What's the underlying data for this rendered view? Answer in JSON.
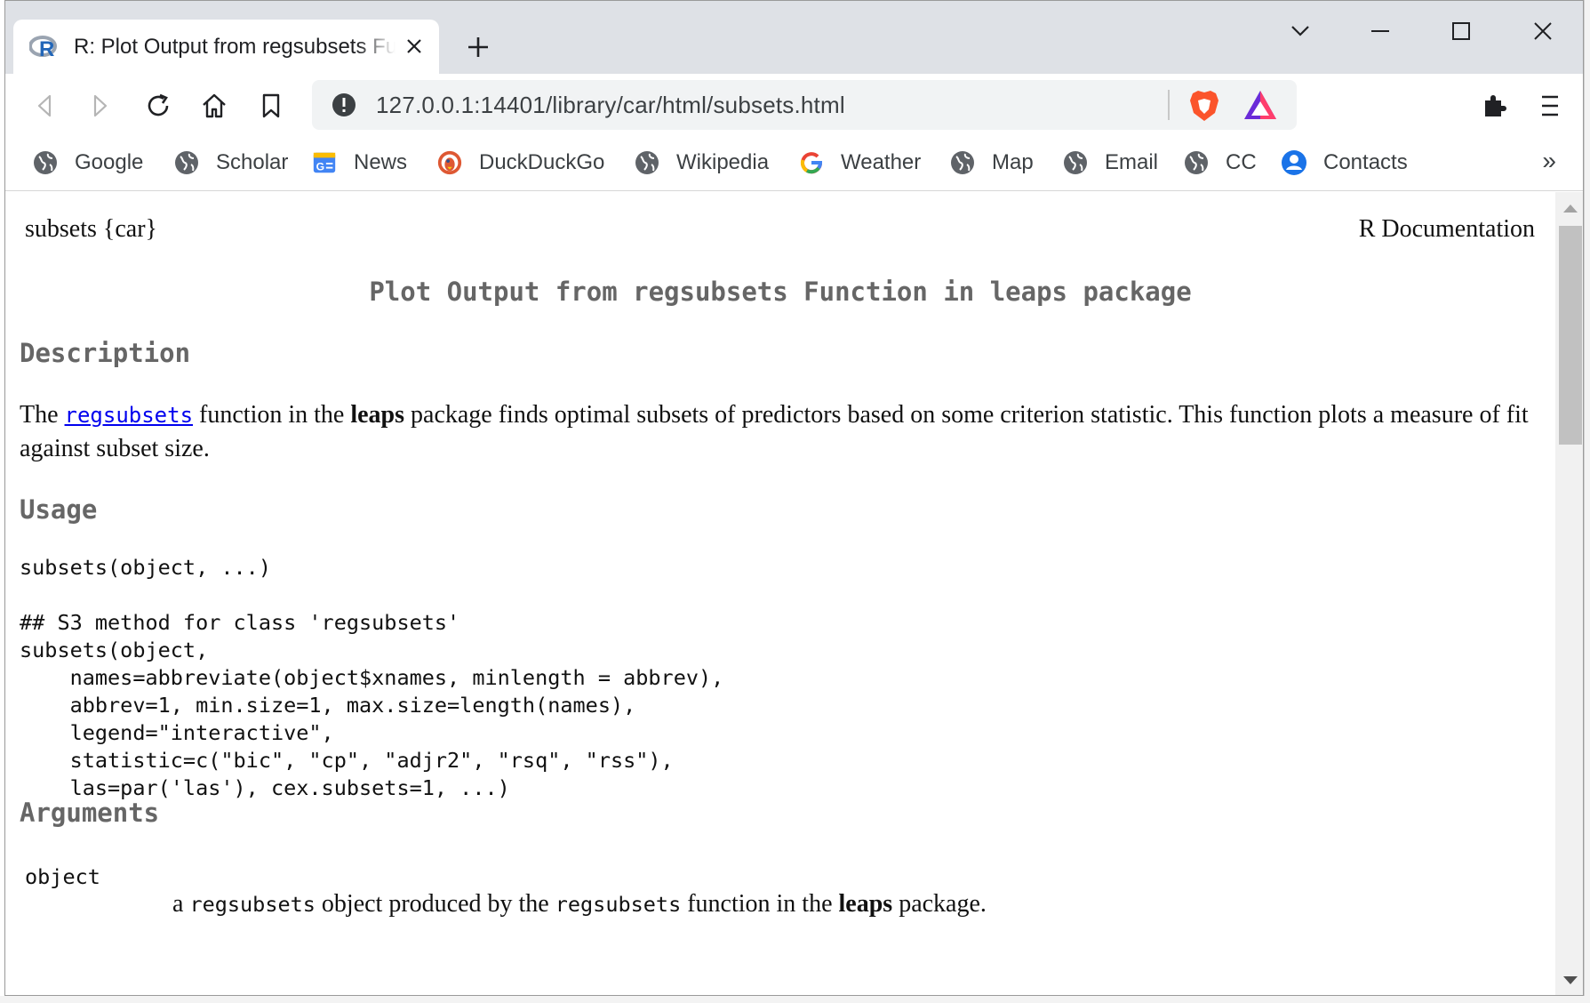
{
  "browser": {
    "tab": {
      "title": "R: Plot Output from regsubsets Function in leaps package"
    },
    "omnibox": {
      "url": "127.0.0.1:14401/library/car/html/subsets.html"
    },
    "bookmarks": [
      {
        "label": "Google",
        "icon": "globe-icon"
      },
      {
        "label": "Scholar",
        "icon": "globe-icon"
      },
      {
        "label": "News",
        "icon": "google-news-icon"
      },
      {
        "label": "DuckDuckGo",
        "icon": "duckduckgo-icon"
      },
      {
        "label": "Wikipedia",
        "icon": "globe-icon"
      },
      {
        "label": "Weather",
        "icon": "google-g-icon"
      },
      {
        "label": "Map",
        "icon": "globe-icon"
      },
      {
        "label": "Email",
        "icon": "globe-icon"
      },
      {
        "label": "CC",
        "icon": "globe-icon"
      },
      {
        "label": "Contacts",
        "icon": "contacts-icon"
      }
    ],
    "more_bookmarks": "»",
    "colors": {
      "tabbar": "#dee1e6",
      "heading": "#666666",
      "link": "#0000ee"
    }
  },
  "doc": {
    "header_left": "subsets {car}",
    "header_right": "R Documentation",
    "title": "Plot Output from regsubsets Function in leaps package",
    "description": {
      "heading": "Description",
      "t1": "The ",
      "link": "regsubsets",
      "t2": " function in the ",
      "bold": "leaps",
      "t3": " package finds optimal subsets of predictors based on some criterion statistic. This function plots a measure of fit against subset size."
    },
    "usage": {
      "heading": "Usage",
      "code1": "subsets(object, ...)",
      "code2": "## S3 method for class 'regsubsets'\nsubsets(object,\n    names=abbreviate(object$xnames, minlength = abbrev),\n    abbrev=1, min.size=1, max.size=length(names),\n    legend=\"interactive\",\n    statistic=c(\"bic\", \"cp\", \"adjr2\", \"rsq\", \"rss\"),\n    las=par('las'), cex.subsets=1, ...)"
    },
    "arguments": {
      "heading": "Arguments",
      "items": [
        {
          "name": "object",
          "d1": "a ",
          "c1": "regsubsets",
          "d2": " object produced by the ",
          "c2": "regsubsets",
          "d3": " function in the ",
          "bold": "leaps",
          "d4": " package."
        }
      ]
    }
  }
}
